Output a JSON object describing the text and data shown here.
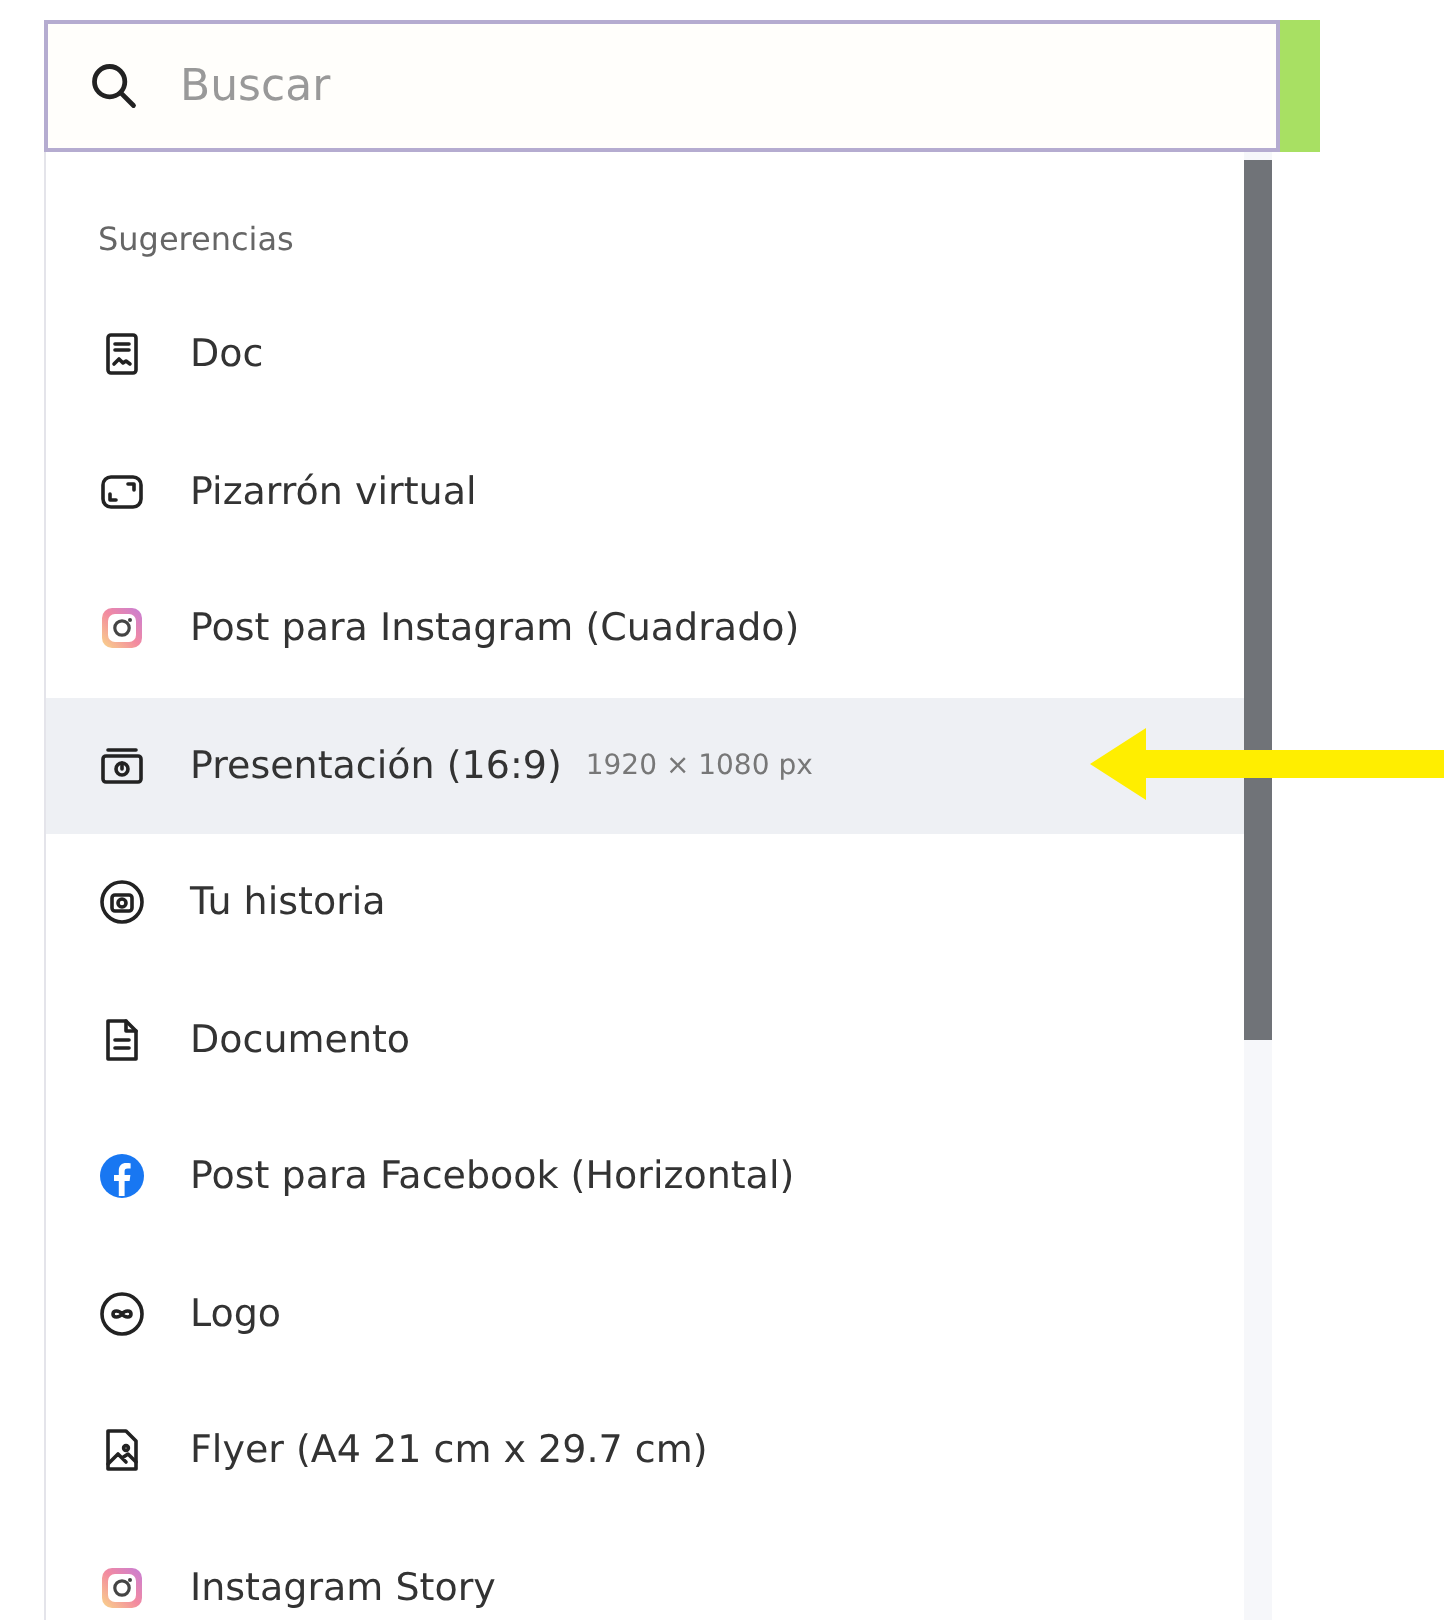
{
  "search": {
    "placeholder": "Buscar"
  },
  "suggestions": {
    "heading": "Sugerencias",
    "items": [
      {
        "kind": "doc",
        "label": "Doc",
        "selected": false
      },
      {
        "kind": "whiteboard",
        "label": "Pizarrón virtual",
        "selected": false
      },
      {
        "kind": "instagram",
        "label": "Post para Instagram (Cuadrado)",
        "selected": false
      },
      {
        "kind": "presentation",
        "label": "Presentación (16:9)",
        "size": "1920 × 1080 px",
        "selected": true
      },
      {
        "kind": "story",
        "label": "Tu historia",
        "selected": false
      },
      {
        "kind": "document",
        "label": "Documento",
        "selected": false
      },
      {
        "kind": "facebook",
        "label": "Post para Facebook (Horizontal)",
        "selected": false
      },
      {
        "kind": "logo",
        "label": "Logo",
        "selected": false
      },
      {
        "kind": "flyer",
        "label": "Flyer (A4 21 cm x 29.7 cm)",
        "selected": false
      },
      {
        "kind": "instagram",
        "label": "Instagram Story",
        "selected": false
      }
    ]
  }
}
